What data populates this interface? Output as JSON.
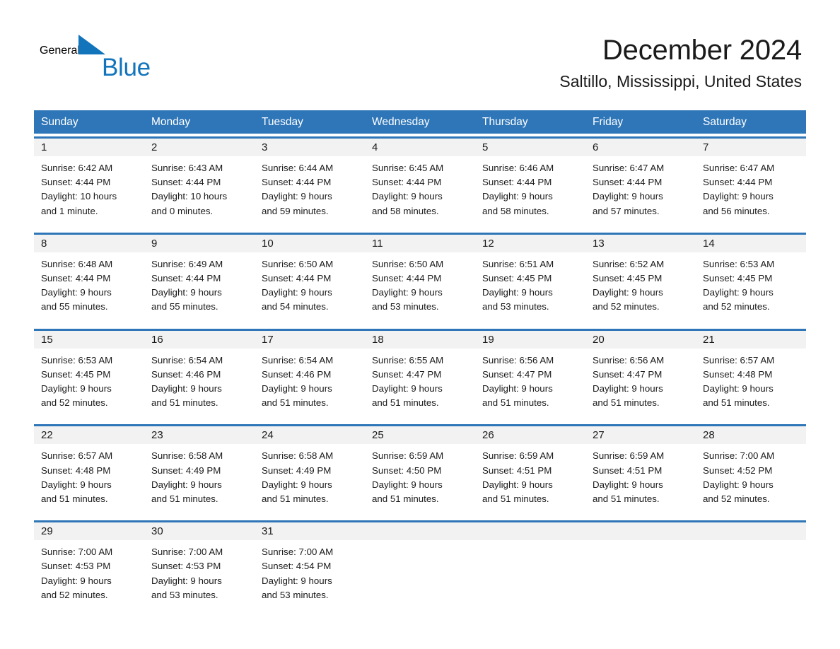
{
  "brand": {
    "name_part1": "General",
    "name_part2": "Blue",
    "triangle_color": "#1275bc"
  },
  "header": {
    "title": "December 2024",
    "location": "Saltillo, Mississippi, United States"
  },
  "theme": {
    "header_bar_color": "#2e76b8",
    "daynum_band_color": "#f2f2f2",
    "row_border_color": "#2e76b8"
  },
  "calendar": {
    "weekday_headers": [
      "Sunday",
      "Monday",
      "Tuesday",
      "Wednesday",
      "Thursday",
      "Friday",
      "Saturday"
    ],
    "weeks": [
      {
        "daynums": [
          "1",
          "2",
          "3",
          "4",
          "5",
          "6",
          "7"
        ],
        "cells": [
          "Sunrise: 6:42 AM\nSunset: 4:44 PM\nDaylight: 10 hours\nand 1 minute.",
          "Sunrise: 6:43 AM\nSunset: 4:44 PM\nDaylight: 10 hours\nand 0 minutes.",
          "Sunrise: 6:44 AM\nSunset: 4:44 PM\nDaylight: 9 hours\nand 59 minutes.",
          "Sunrise: 6:45 AM\nSunset: 4:44 PM\nDaylight: 9 hours\nand 58 minutes.",
          "Sunrise: 6:46 AM\nSunset: 4:44 PM\nDaylight: 9 hours\nand 58 minutes.",
          "Sunrise: 6:47 AM\nSunset: 4:44 PM\nDaylight: 9 hours\nand 57 minutes.",
          "Sunrise: 6:47 AM\nSunset: 4:44 PM\nDaylight: 9 hours\nand 56 minutes."
        ]
      },
      {
        "daynums": [
          "8",
          "9",
          "10",
          "11",
          "12",
          "13",
          "14"
        ],
        "cells": [
          "Sunrise: 6:48 AM\nSunset: 4:44 PM\nDaylight: 9 hours\nand 55 minutes.",
          "Sunrise: 6:49 AM\nSunset: 4:44 PM\nDaylight: 9 hours\nand 55 minutes.",
          "Sunrise: 6:50 AM\nSunset: 4:44 PM\nDaylight: 9 hours\nand 54 minutes.",
          "Sunrise: 6:50 AM\nSunset: 4:44 PM\nDaylight: 9 hours\nand 53 minutes.",
          "Sunrise: 6:51 AM\nSunset: 4:45 PM\nDaylight: 9 hours\nand 53 minutes.",
          "Sunrise: 6:52 AM\nSunset: 4:45 PM\nDaylight: 9 hours\nand 52 minutes.",
          "Sunrise: 6:53 AM\nSunset: 4:45 PM\nDaylight: 9 hours\nand 52 minutes."
        ]
      },
      {
        "daynums": [
          "15",
          "16",
          "17",
          "18",
          "19",
          "20",
          "21"
        ],
        "cells": [
          "Sunrise: 6:53 AM\nSunset: 4:45 PM\nDaylight: 9 hours\nand 52 minutes.",
          "Sunrise: 6:54 AM\nSunset: 4:46 PM\nDaylight: 9 hours\nand 51 minutes.",
          "Sunrise: 6:54 AM\nSunset: 4:46 PM\nDaylight: 9 hours\nand 51 minutes.",
          "Sunrise: 6:55 AM\nSunset: 4:47 PM\nDaylight: 9 hours\nand 51 minutes.",
          "Sunrise: 6:56 AM\nSunset: 4:47 PM\nDaylight: 9 hours\nand 51 minutes.",
          "Sunrise: 6:56 AM\nSunset: 4:47 PM\nDaylight: 9 hours\nand 51 minutes.",
          "Sunrise: 6:57 AM\nSunset: 4:48 PM\nDaylight: 9 hours\nand 51 minutes."
        ]
      },
      {
        "daynums": [
          "22",
          "23",
          "24",
          "25",
          "26",
          "27",
          "28"
        ],
        "cells": [
          "Sunrise: 6:57 AM\nSunset: 4:48 PM\nDaylight: 9 hours\nand 51 minutes.",
          "Sunrise: 6:58 AM\nSunset: 4:49 PM\nDaylight: 9 hours\nand 51 minutes.",
          "Sunrise: 6:58 AM\nSunset: 4:49 PM\nDaylight: 9 hours\nand 51 minutes.",
          "Sunrise: 6:59 AM\nSunset: 4:50 PM\nDaylight: 9 hours\nand 51 minutes.",
          "Sunrise: 6:59 AM\nSunset: 4:51 PM\nDaylight: 9 hours\nand 51 minutes.",
          "Sunrise: 6:59 AM\nSunset: 4:51 PM\nDaylight: 9 hours\nand 51 minutes.",
          "Sunrise: 7:00 AM\nSunset: 4:52 PM\nDaylight: 9 hours\nand 52 minutes."
        ]
      },
      {
        "daynums": [
          "29",
          "30",
          "31",
          "",
          "",
          "",
          ""
        ],
        "cells": [
          "Sunrise: 7:00 AM\nSunset: 4:53 PM\nDaylight: 9 hours\nand 52 minutes.",
          "Sunrise: 7:00 AM\nSunset: 4:53 PM\nDaylight: 9 hours\nand 53 minutes.",
          "Sunrise: 7:00 AM\nSunset: 4:54 PM\nDaylight: 9 hours\nand 53 minutes.",
          "",
          "",
          "",
          ""
        ]
      }
    ]
  }
}
